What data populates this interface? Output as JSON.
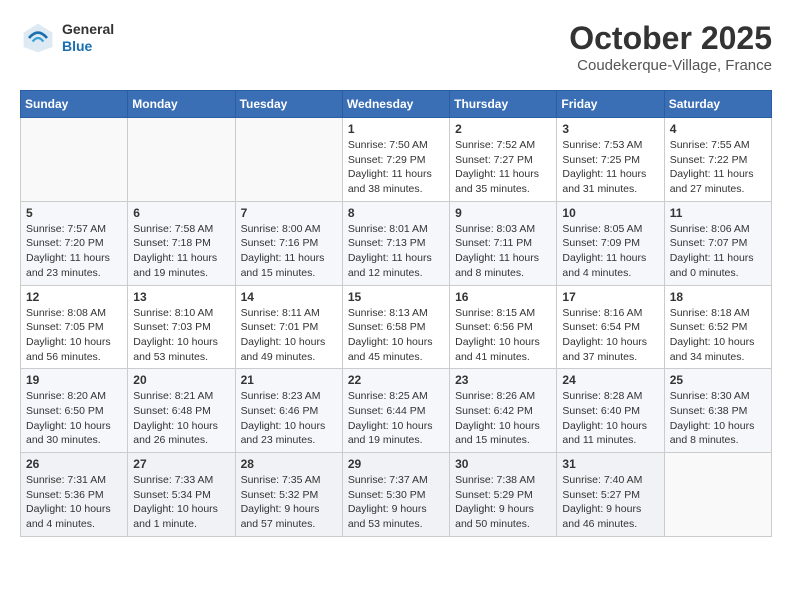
{
  "header": {
    "logo_general": "General",
    "logo_blue": "Blue",
    "title": "October 2025",
    "subtitle": "Coudekerque-Village, France"
  },
  "days_of_week": [
    "Sunday",
    "Monday",
    "Tuesday",
    "Wednesday",
    "Thursday",
    "Friday",
    "Saturday"
  ],
  "weeks": [
    [
      {
        "day": "",
        "info": ""
      },
      {
        "day": "",
        "info": ""
      },
      {
        "day": "",
        "info": ""
      },
      {
        "day": "1",
        "info": "Sunrise: 7:50 AM\nSunset: 7:29 PM\nDaylight: 11 hours\nand 38 minutes."
      },
      {
        "day": "2",
        "info": "Sunrise: 7:52 AM\nSunset: 7:27 PM\nDaylight: 11 hours\nand 35 minutes."
      },
      {
        "day": "3",
        "info": "Sunrise: 7:53 AM\nSunset: 7:25 PM\nDaylight: 11 hours\nand 31 minutes."
      },
      {
        "day": "4",
        "info": "Sunrise: 7:55 AM\nSunset: 7:22 PM\nDaylight: 11 hours\nand 27 minutes."
      }
    ],
    [
      {
        "day": "5",
        "info": "Sunrise: 7:57 AM\nSunset: 7:20 PM\nDaylight: 11 hours\nand 23 minutes."
      },
      {
        "day": "6",
        "info": "Sunrise: 7:58 AM\nSunset: 7:18 PM\nDaylight: 11 hours\nand 19 minutes."
      },
      {
        "day": "7",
        "info": "Sunrise: 8:00 AM\nSunset: 7:16 PM\nDaylight: 11 hours\nand 15 minutes."
      },
      {
        "day": "8",
        "info": "Sunrise: 8:01 AM\nSunset: 7:13 PM\nDaylight: 11 hours\nand 12 minutes."
      },
      {
        "day": "9",
        "info": "Sunrise: 8:03 AM\nSunset: 7:11 PM\nDaylight: 11 hours\nand 8 minutes."
      },
      {
        "day": "10",
        "info": "Sunrise: 8:05 AM\nSunset: 7:09 PM\nDaylight: 11 hours\nand 4 minutes."
      },
      {
        "day": "11",
        "info": "Sunrise: 8:06 AM\nSunset: 7:07 PM\nDaylight: 11 hours\nand 0 minutes."
      }
    ],
    [
      {
        "day": "12",
        "info": "Sunrise: 8:08 AM\nSunset: 7:05 PM\nDaylight: 10 hours\nand 56 minutes."
      },
      {
        "day": "13",
        "info": "Sunrise: 8:10 AM\nSunset: 7:03 PM\nDaylight: 10 hours\nand 53 minutes."
      },
      {
        "day": "14",
        "info": "Sunrise: 8:11 AM\nSunset: 7:01 PM\nDaylight: 10 hours\nand 49 minutes."
      },
      {
        "day": "15",
        "info": "Sunrise: 8:13 AM\nSunset: 6:58 PM\nDaylight: 10 hours\nand 45 minutes."
      },
      {
        "day": "16",
        "info": "Sunrise: 8:15 AM\nSunset: 6:56 PM\nDaylight: 10 hours\nand 41 minutes."
      },
      {
        "day": "17",
        "info": "Sunrise: 8:16 AM\nSunset: 6:54 PM\nDaylight: 10 hours\nand 37 minutes."
      },
      {
        "day": "18",
        "info": "Sunrise: 8:18 AM\nSunset: 6:52 PM\nDaylight: 10 hours\nand 34 minutes."
      }
    ],
    [
      {
        "day": "19",
        "info": "Sunrise: 8:20 AM\nSunset: 6:50 PM\nDaylight: 10 hours\nand 30 minutes."
      },
      {
        "day": "20",
        "info": "Sunrise: 8:21 AM\nSunset: 6:48 PM\nDaylight: 10 hours\nand 26 minutes."
      },
      {
        "day": "21",
        "info": "Sunrise: 8:23 AM\nSunset: 6:46 PM\nDaylight: 10 hours\nand 23 minutes."
      },
      {
        "day": "22",
        "info": "Sunrise: 8:25 AM\nSunset: 6:44 PM\nDaylight: 10 hours\nand 19 minutes."
      },
      {
        "day": "23",
        "info": "Sunrise: 8:26 AM\nSunset: 6:42 PM\nDaylight: 10 hours\nand 15 minutes."
      },
      {
        "day": "24",
        "info": "Sunrise: 8:28 AM\nSunset: 6:40 PM\nDaylight: 10 hours\nand 11 minutes."
      },
      {
        "day": "25",
        "info": "Sunrise: 8:30 AM\nSunset: 6:38 PM\nDaylight: 10 hours\nand 8 minutes."
      }
    ],
    [
      {
        "day": "26",
        "info": "Sunrise: 7:31 AM\nSunset: 5:36 PM\nDaylight: 10 hours\nand 4 minutes."
      },
      {
        "day": "27",
        "info": "Sunrise: 7:33 AM\nSunset: 5:34 PM\nDaylight: 10 hours\nand 1 minute."
      },
      {
        "day": "28",
        "info": "Sunrise: 7:35 AM\nSunset: 5:32 PM\nDaylight: 9 hours\nand 57 minutes."
      },
      {
        "day": "29",
        "info": "Sunrise: 7:37 AM\nSunset: 5:30 PM\nDaylight: 9 hours\nand 53 minutes."
      },
      {
        "day": "30",
        "info": "Sunrise: 7:38 AM\nSunset: 5:29 PM\nDaylight: 9 hours\nand 50 minutes."
      },
      {
        "day": "31",
        "info": "Sunrise: 7:40 AM\nSunset: 5:27 PM\nDaylight: 9 hours\nand 46 minutes."
      },
      {
        "day": "",
        "info": ""
      }
    ]
  ]
}
